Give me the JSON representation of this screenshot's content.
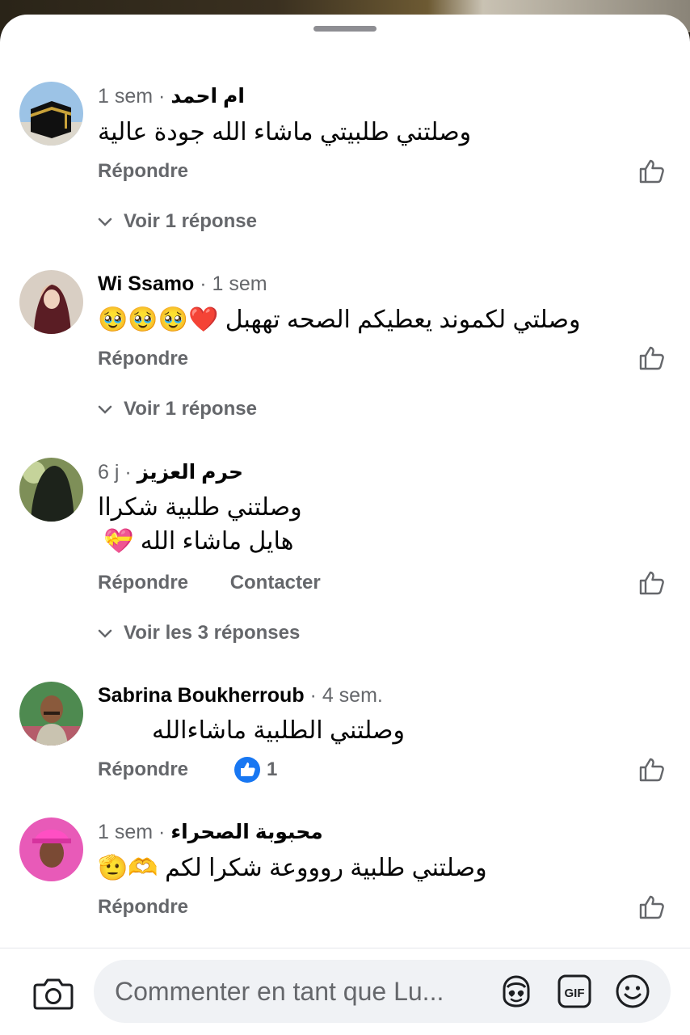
{
  "comments": [
    {
      "author": "ام احمد",
      "time": "1 sem",
      "lines": [
        "وصلتني طلبيتي ماشاء الله جودة عالية"
      ],
      "emoji": "",
      "reply_label": "Répondre",
      "view_replies": "Voir 1 réponse"
    },
    {
      "author": "Wi Ssamo",
      "time": "1 sem",
      "lines": [
        "وصلتي لكموند يعطيكم الصحه تههبل"
      ],
      "emoji": "🥹🥹🥹❤️",
      "reply_label": "Répondre",
      "view_replies": "Voir 1 réponse"
    },
    {
      "author": "حرم العزيز",
      "time": "6 j",
      "lines": [
        "وصلتني طلبية شكراا",
        "هايل ماشاء الله"
      ],
      "emoji": "💝",
      "reply_label": "Répondre",
      "contact_label": "Contacter",
      "view_replies": "Voir les 3 réponses"
    },
    {
      "author": "Sabrina Boukherroub",
      "time": "4 sem.",
      "lines": [
        "وصلتني الطلبية ماشاءالله"
      ],
      "emoji": "",
      "reply_label": "Répondre",
      "reaction_count": "1"
    },
    {
      "author": "محبوبة  الصحراء",
      "time": "1 sem",
      "lines": [
        "وصلتني طلبية روووعة شكرا لكم"
      ],
      "emoji": "🫡🫶",
      "reply_label": "Répondre"
    }
  ],
  "composer": {
    "placeholder": "Commenter en tant que Lu...",
    "gif_label": "GIF",
    "icons": [
      "camera-icon",
      "avatar-sticker-icon",
      "gif-icon",
      "smiley-icon"
    ]
  },
  "colors": {
    "secondary_text": "#65676b",
    "primary_text": "#050505",
    "like_blue": "#1877f2",
    "composer_bg": "#f0f2f5"
  }
}
